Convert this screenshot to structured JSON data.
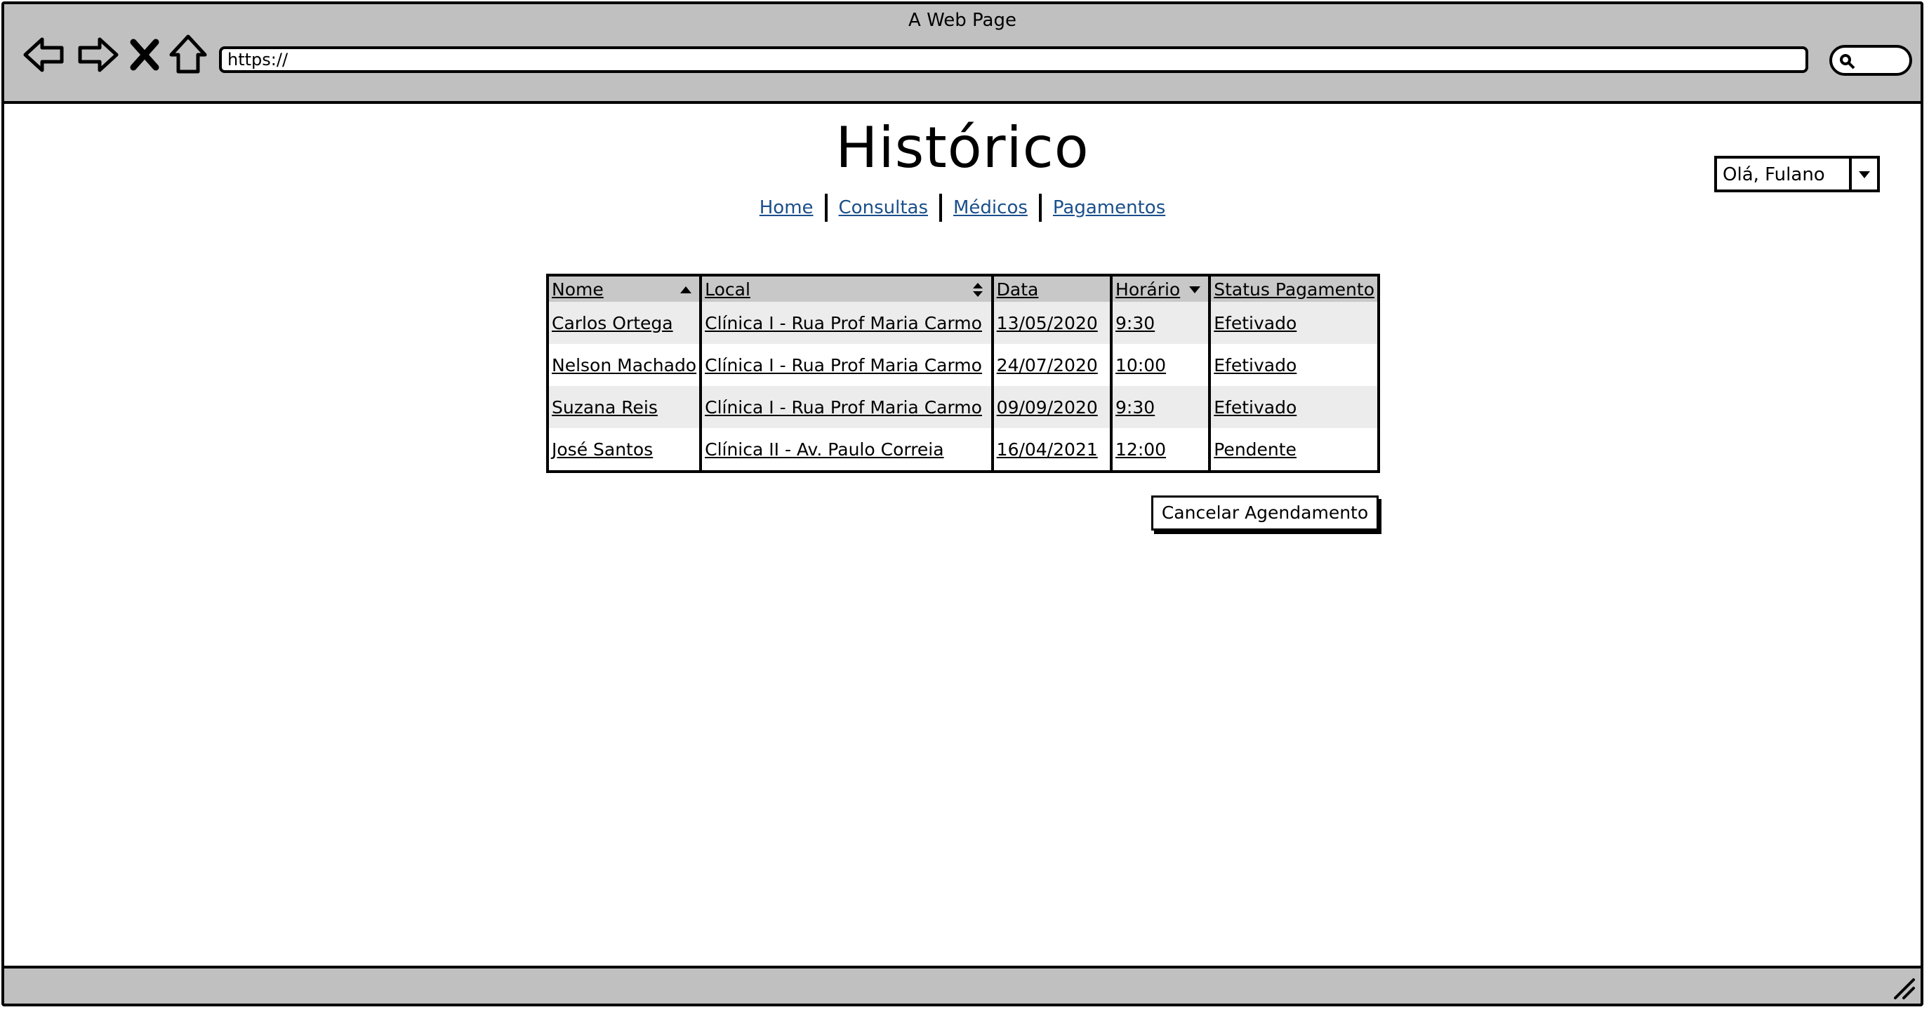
{
  "browser": {
    "window_title": "A Web Page",
    "url": "https://"
  },
  "page": {
    "title": "Histórico",
    "nav": [
      "Home",
      "Consultas",
      "Médicos",
      "Pagamentos"
    ],
    "user_menu": "Olá, Fulano"
  },
  "table": {
    "columns": [
      "Nome",
      "Local",
      "Data",
      "Horário",
      "Status Pagamento"
    ],
    "rows": [
      [
        "Carlos Ortega",
        "Clínica I - Rua Prof Maria Carmo",
        "13/05/2020",
        "9:30",
        "Efetivado"
      ],
      [
        "Nelson Machado",
        "Clínica I - Rua Prof Maria Carmo",
        "24/07/2020",
        "10:00",
        "Efetivado"
      ],
      [
        "Suzana Reis",
        "Clínica I - Rua Prof Maria Carmo",
        "09/09/2020",
        "9:30",
        "Efetivado"
      ],
      [
        "José Santos",
        "Clínica II - Av. Paulo Correia",
        "16/04/2021",
        "12:00",
        "Pendente"
      ]
    ]
  },
  "actions": {
    "cancel_label": "Cancelar Agendamento"
  },
  "icons": {
    "back": "back-arrow-icon",
    "forward": "forward-arrow-icon",
    "stop": "close-icon",
    "home": "home-icon",
    "search": "search-icon",
    "dropdown": "chevron-down-icon",
    "sort_asc": "sort-asc-icon",
    "sort_both": "sort-both-icon",
    "sort_desc": "sort-desc-icon",
    "resize": "resize-grip-icon"
  }
}
